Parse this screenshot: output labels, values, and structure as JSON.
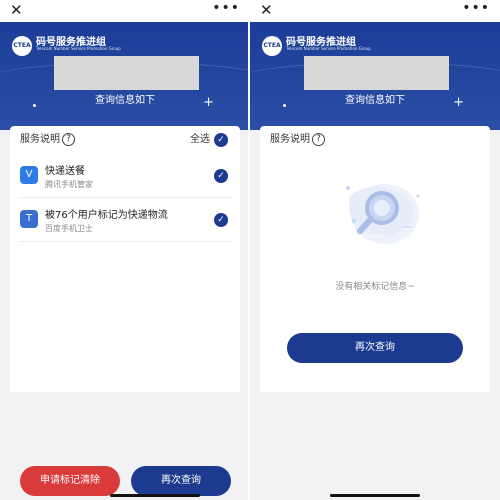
{
  "topbar": {
    "close_glyph": "✕",
    "more_glyph": "•••",
    "close_icon": "close-icon",
    "more_icon": "more-icon"
  },
  "header": {
    "brand_name": "码号服务推进组",
    "brand_en": "Telecom Number Service Promotion Group",
    "logo_text": "CTEA",
    "info_title": "查询信息如下",
    "plus_glyph": "+"
  },
  "left": {
    "card_title": "服务说明",
    "help_glyph": "?",
    "select_all": "全选",
    "check_glyph": "✓",
    "items": [
      {
        "title": "快递送餐",
        "source": "腾讯手机管家",
        "icon": "shield-v-icon",
        "icon_glyph": "V",
        "icon_color": "#2f7be6"
      },
      {
        "title": "被76个用户标记为快递物流",
        "source": "百度手机卫士",
        "icon": "shield-t-icon",
        "icon_glyph": "T",
        "icon_color": "#3a6fd0"
      }
    ],
    "clear_button": "申请标记清除",
    "requery_button": "再次查询"
  },
  "right": {
    "card_title": "服务说明",
    "help_glyph": "?",
    "empty_text": "没有相关标记信息~",
    "requery_button": "再次查询"
  },
  "colors": {
    "primary": "#1c3a8f",
    "danger": "#d93a3a",
    "header": "#1b3d97"
  }
}
